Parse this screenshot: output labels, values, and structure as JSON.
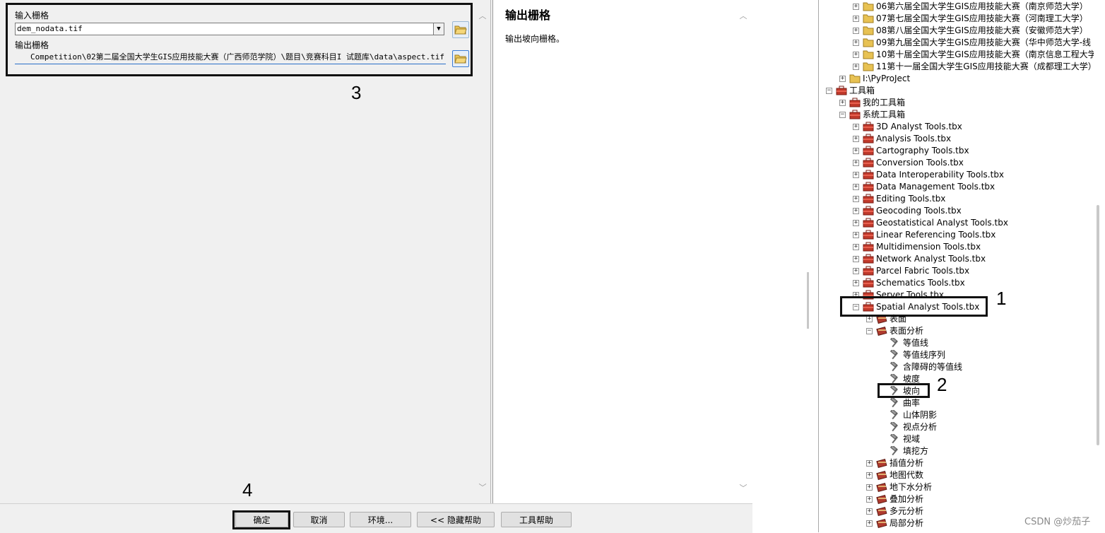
{
  "dialog": {
    "input_label": "输入栅格",
    "input_value": "dem_nodata.tif",
    "output_label": "输出栅格",
    "output_value": "Competition\\02第二届全国大学生GIS应用技能大赛（广西师范学院）\\题目\\竞赛科目I  试题库\\data\\aspect.tif",
    "callout_params": "3",
    "callout_ok": "4"
  },
  "help": {
    "title": "输出栅格",
    "body": "输出坡向栅格。"
  },
  "buttons": {
    "ok": "确定",
    "cancel": "取消",
    "env": "环境...",
    "hide_help": "<< 隐藏帮助",
    "tool_help": "工具帮助"
  },
  "catalog": {
    "folders": [
      "06第六届全国大学生GIS应用技能大赛（南京师范大学）",
      "07第七届全国大学生GIS应用技能大赛（河南理工大学）",
      "08第八届全国大学生GIS应用技能大赛（安徽师范大学）",
      "09第九届全国大学生GIS应用技能大赛（华中师范大学-线",
      "10第十届全国大学生GIS应用技能大赛（南京信息工程大学",
      "11第十一届全国大学生GIS应用技能大赛（成都理工大学）"
    ],
    "pyproject": "I:\\PyProJect",
    "toolboxes": "工具箱",
    "my_toolboxes": "我的工具箱",
    "system_toolboxes": "系统工具箱",
    "tbx": [
      "3D Analyst Tools.tbx",
      "Analysis Tools.tbx",
      "Cartography Tools.tbx",
      "Conversion Tools.tbx",
      "Data Interoperability Tools.tbx",
      "Data Management Tools.tbx",
      "Editing Tools.tbx",
      "Geocoding Tools.tbx",
      "Geostatistical Analyst Tools.tbx",
      "Linear Referencing Tools.tbx",
      "Multidimension Tools.tbx",
      "Network Analyst Tools.tbx",
      "Parcel Fabric Tools.tbx",
      "Schematics Tools.tbx",
      "Server Tools.tbx"
    ],
    "spatial": "Spatial Analyst Tools.tbx",
    "surface": "表面",
    "surface_analysis": "表面分析",
    "surface_tools": [
      "等值线",
      "等值线序列",
      "含障碍的等值线",
      "坡度",
      "坡向",
      "曲率",
      "山体阴影",
      "视点分析",
      "视域",
      "填挖方"
    ],
    "toolsets_after": [
      "插值分析",
      "地图代数",
      "地下水分析",
      "叠加分析",
      "多元分析",
      "局部分析"
    ],
    "callout_spatial": "1",
    "callout_aspect": "2"
  },
  "watermark": "CSDN @炒茄子",
  "colors": {
    "toolbox_red": "#c0392b",
    "folder_yellow": "#e8c253",
    "input_underline": "#2a6fc9"
  }
}
